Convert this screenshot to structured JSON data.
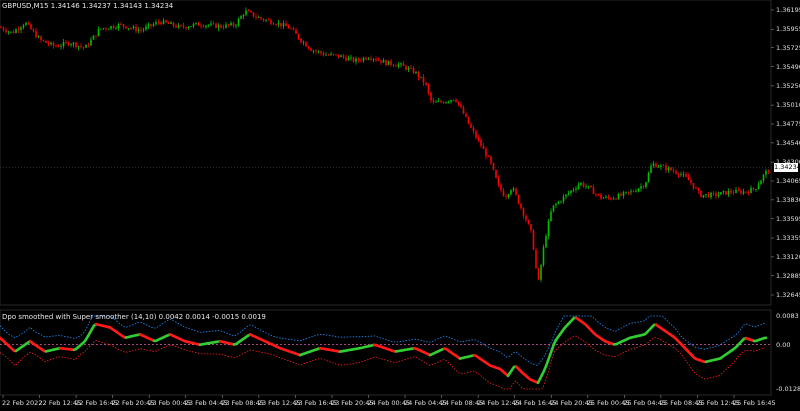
{
  "chart_title": "GBPUSD,M15  1.34146 1.34237 1.34143 1.34234",
  "indicator_title": "Dpo smoothed with Super smoother (14,10) 0.0042 0.0014 -0.0015 0.0019",
  "current_price": "1.34234",
  "colors": {
    "background": "#000000",
    "bull": "#00c000",
    "bear": "#ff0000",
    "grid": "#1a1a3a",
    "indicator_up": "#32cd32",
    "indicator_down": "#ff1a1a",
    "band_upper": "#1e90ff",
    "band_lower": "#ff2020",
    "zero_line": "#ff77c8"
  },
  "price_axis": [
    "1.36195",
    "1.35955",
    "1.35725",
    "1.35490",
    "1.35250",
    "1.35010",
    "1.34775",
    "1.34540",
    "1.34300",
    "1.34065",
    "1.33830",
    "1.33595",
    "1.33355",
    "1.33120",
    "1.32885",
    "1.32645"
  ],
  "indicator_axis": [
    "0.0083",
    "0.00",
    "-0.0128"
  ],
  "time_axis": [
    "22 Feb 2022",
    "22 Feb 12:45",
    "22 Feb 16:45",
    "22 Feb 20:45",
    "23 Feb 00:45",
    "23 Feb 04:45",
    "23 Feb 08:45",
    "23 Feb 12:45",
    "23 Feb 16:45",
    "23 Feb 20:45",
    "24 Feb 00:45",
    "24 Feb 04:45",
    "24 Feb 08:45",
    "24 Feb 12:45",
    "24 Feb 16:45",
    "24 Feb 20:45",
    "25 Feb 00:45",
    "25 Feb 04:45",
    "25 Feb 08:45",
    "25 Feb 12:45",
    "25 Feb 16:45"
  ],
  "chart_data": {
    "type": "candlestick",
    "symbol": "GBPUSD",
    "timeframe": "M15",
    "ylim": [
      1.32645,
      1.36195
    ],
    "price_path": [
      [
        0,
        1.3598
      ],
      [
        12,
        1.3591
      ],
      [
        25,
        1.3604
      ],
      [
        40,
        1.3582
      ],
      [
        55,
        1.3574
      ],
      [
        70,
        1.3579
      ],
      [
        85,
        1.3572
      ],
      [
        100,
        1.3596
      ],
      [
        120,
        1.3601
      ],
      [
        140,
        1.3594
      ],
      [
        160,
        1.3605
      ],
      [
        180,
        1.3598
      ],
      [
        200,
        1.3602
      ],
      [
        220,
        1.3599
      ],
      [
        235,
        1.3601
      ],
      [
        245,
        1.3618
      ],
      [
        260,
        1.3609
      ],
      [
        275,
        1.3604
      ],
      [
        290,
        1.3597
      ],
      [
        300,
        1.3583
      ],
      [
        312,
        1.357
      ],
      [
        325,
        1.3564
      ],
      [
        340,
        1.3562
      ],
      [
        355,
        1.3556
      ],
      [
        370,
        1.3562
      ],
      [
        385,
        1.3554
      ],
      [
        400,
        1.3551
      ],
      [
        415,
        1.3542
      ],
      [
        425,
        1.3528
      ],
      [
        432,
        1.3503
      ],
      [
        445,
        1.3506
      ],
      [
        455,
        1.351
      ],
      [
        462,
        1.3494
      ],
      [
        470,
        1.3474
      ],
      [
        480,
        1.3453
      ],
      [
        490,
        1.3431
      ],
      [
        498,
        1.3401
      ],
      [
        505,
        1.3387
      ],
      [
        512,
        1.3399
      ],
      [
        518,
        1.3382
      ],
      [
        525,
        1.3362
      ],
      [
        532,
        1.3339
      ],
      [
        538,
        1.3277
      ],
      [
        545,
        1.3335
      ],
      [
        552,
        1.3373
      ],
      [
        560,
        1.3382
      ],
      [
        570,
        1.3393
      ],
      [
        580,
        1.3404
      ],
      [
        590,
        1.3397
      ],
      [
        600,
        1.3386
      ],
      [
        610,
        1.3385
      ],
      [
        620,
        1.3388
      ],
      [
        632,
        1.3393
      ],
      [
        645,
        1.3403
      ],
      [
        652,
        1.3428
      ],
      [
        665,
        1.3423
      ],
      [
        680,
        1.3416
      ],
      [
        690,
        1.3406
      ],
      [
        700,
        1.3389
      ],
      [
        715,
        1.3389
      ],
      [
        730,
        1.3393
      ],
      [
        745,
        1.3393
      ],
      [
        755,
        1.3397
      ],
      [
        765,
        1.3416
      ],
      [
        770,
        1.3423
      ]
    ],
    "indicator": {
      "name": "Dpo smoothed with Super smoother",
      "params": [
        14,
        10
      ],
      "ylim": [
        -0.0128,
        0.0083
      ],
      "values_path": [
        [
          0,
          0.002
        ],
        [
          15,
          -0.002
        ],
        [
          30,
          0.001
        ],
        [
          45,
          -0.002
        ],
        [
          60,
          -0.001
        ],
        [
          75,
          -0.0015
        ],
        [
          85,
          0.001
        ],
        [
          95,
          0.006
        ],
        [
          110,
          0.005
        ],
        [
          125,
          0.002
        ],
        [
          140,
          0.003
        ],
        [
          155,
          0.001
        ],
        [
          170,
          0.003
        ],
        [
          185,
          0.001
        ],
        [
          200,
          0.0
        ],
        [
          220,
          0.001
        ],
        [
          235,
          0.0
        ],
        [
          250,
          0.003
        ],
        [
          265,
          0.001
        ],
        [
          280,
          -0.001
        ],
        [
          300,
          -0.003
        ],
        [
          320,
          -0.001
        ],
        [
          340,
          -0.002
        ],
        [
          360,
          -0.001
        ],
        [
          375,
          0.0
        ],
        [
          395,
          -0.002
        ],
        [
          415,
          -0.001
        ],
        [
          430,
          -0.003
        ],
        [
          445,
          -0.001
        ],
        [
          460,
          -0.004
        ],
        [
          475,
          -0.003
        ],
        [
          490,
          -0.006
        ],
        [
          500,
          -0.007
        ],
        [
          508,
          -0.009
        ],
        [
          515,
          -0.006
        ],
        [
          522,
          -0.008
        ],
        [
          530,
          -0.01
        ],
        [
          538,
          -0.011
        ],
        [
          545,
          -0.007
        ],
        [
          555,
          0.001
        ],
        [
          565,
          0.005
        ],
        [
          575,
          0.008
        ],
        [
          585,
          0.006
        ],
        [
          595,
          0.003
        ],
        [
          605,
          0.001
        ],
        [
          615,
          0.0
        ],
        [
          630,
          0.002
        ],
        [
          645,
          0.003
        ],
        [
          655,
          0.006
        ],
        [
          665,
          0.004
        ],
        [
          675,
          0.002
        ],
        [
          685,
          -0.001
        ],
        [
          695,
          -0.004
        ],
        [
          705,
          -0.005
        ],
        [
          720,
          -0.004
        ],
        [
          735,
          -0.001
        ],
        [
          745,
          0.002
        ],
        [
          755,
          0.001
        ],
        [
          765,
          0.002
        ]
      ]
    }
  }
}
